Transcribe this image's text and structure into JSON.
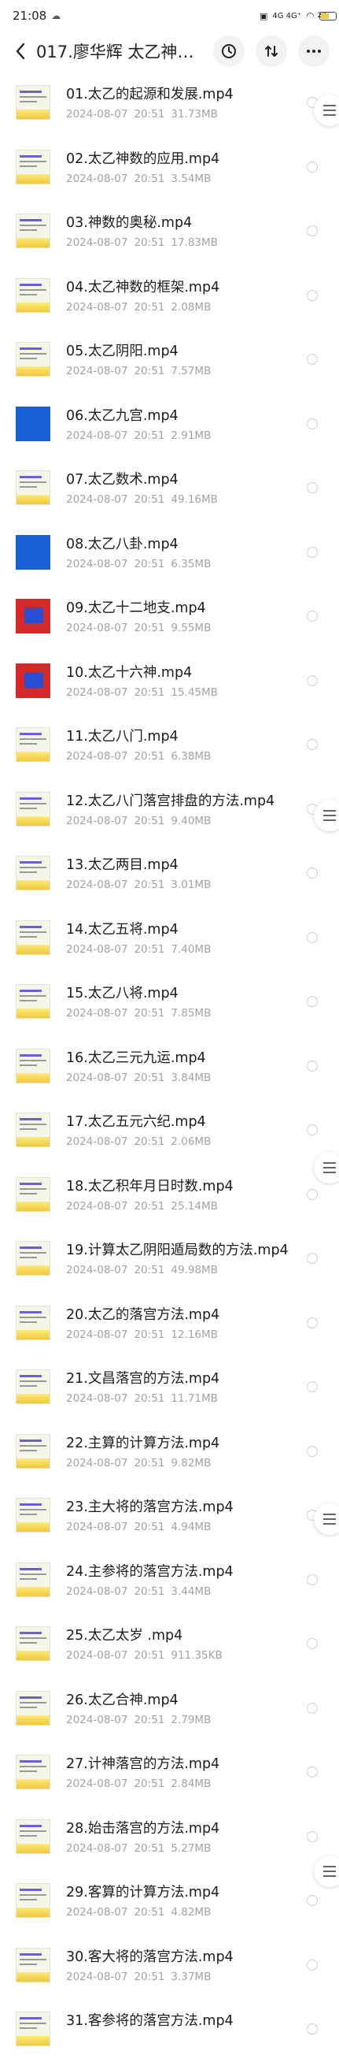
{
  "status": {
    "time": "21:08",
    "network": "4G 4G⁺",
    "battery": "27"
  },
  "header": {
    "title": "017.廖华辉 太乙神…"
  },
  "files": [
    {
      "name": "01.太乙的起源和发展.mp4",
      "date": "2024-08-07",
      "time": "20:51",
      "size": "31.73MB",
      "thumb": "text"
    },
    {
      "name": "02.太乙神数的应用.mp4",
      "date": "2024-08-07",
      "time": "20:51",
      "size": "3.54MB",
      "thumb": "text"
    },
    {
      "name": "03.神数的奥秘.mp4",
      "date": "2024-08-07",
      "time": "20:51",
      "size": "17.83MB",
      "thumb": "text"
    },
    {
      "name": "04.太乙神数的框架.mp4",
      "date": "2024-08-07",
      "time": "20:51",
      "size": "2.08MB",
      "thumb": "text"
    },
    {
      "name": "05.太乙阴阳.mp4",
      "date": "2024-08-07",
      "time": "20:51",
      "size": "7.57MB",
      "thumb": "text"
    },
    {
      "name": "06.太乙九宫.mp4",
      "date": "2024-08-07",
      "time": "20:51",
      "size": "2.91MB",
      "thumb": "blue"
    },
    {
      "name": "07.太乙数术.mp4",
      "date": "2024-08-07",
      "time": "20:51",
      "size": "49.16MB",
      "thumb": "text"
    },
    {
      "name": "08.太乙八卦.mp4",
      "date": "2024-08-07",
      "time": "20:51",
      "size": "6.35MB",
      "thumb": "blue"
    },
    {
      "name": "09.太乙十二地支.mp4",
      "date": "2024-08-07",
      "time": "20:51",
      "size": "9.55MB",
      "thumb": "red"
    },
    {
      "name": "10.太乙十六神.mp4",
      "date": "2024-08-07",
      "time": "20:51",
      "size": "15.45MB",
      "thumb": "red"
    },
    {
      "name": "11.太乙八门.mp4",
      "date": "2024-08-07",
      "time": "20:51",
      "size": "6.38MB",
      "thumb": "text"
    },
    {
      "name": "12.太乙八门落宫排盘的方法.mp4",
      "date": "2024-08-07",
      "time": "20:51",
      "size": "9.40MB",
      "thumb": "text"
    },
    {
      "name": "13.太乙两目.mp4",
      "date": "2024-08-07",
      "time": "20:51",
      "size": "3.01MB",
      "thumb": "text"
    },
    {
      "name": "14.太乙五将.mp4",
      "date": "2024-08-07",
      "time": "20:51",
      "size": "7.40MB",
      "thumb": "text"
    },
    {
      "name": "15.太乙八将.mp4",
      "date": "2024-08-07",
      "time": "20:51",
      "size": "7.85MB",
      "thumb": "text"
    },
    {
      "name": "16.太乙三元九运.mp4",
      "date": "2024-08-07",
      "time": "20:51",
      "size": "3.84MB",
      "thumb": "text"
    },
    {
      "name": "17.太乙五元六纪.mp4",
      "date": "2024-08-07",
      "time": "20:51",
      "size": "2.06MB",
      "thumb": "text"
    },
    {
      "name": "18.太乙积年月日时数.mp4",
      "date": "2024-08-07",
      "time": "20:51",
      "size": "25.14MB",
      "thumb": "text"
    },
    {
      "name": "19.计算太乙阴阳遁局数的方法.mp4",
      "date": "2024-08-07",
      "time": "20:51",
      "size": "49.98MB",
      "thumb": "text"
    },
    {
      "name": "20.太乙的落宫方法.mp4",
      "date": "2024-08-07",
      "time": "20:51",
      "size": "12.16MB",
      "thumb": "text"
    },
    {
      "name": "21.文昌落宫的方法.mp4",
      "date": "2024-08-07",
      "time": "20:51",
      "size": "11.71MB",
      "thumb": "text"
    },
    {
      "name": "22.主算的计算方法.mp4",
      "date": "2024-08-07",
      "time": "20:51",
      "size": "9.82MB",
      "thumb": "text"
    },
    {
      "name": "23.主大将的落宫方法.mp4",
      "date": "2024-08-07",
      "time": "20:51",
      "size": "4.94MB",
      "thumb": "text"
    },
    {
      "name": "24.主参将的落宫方法.mp4",
      "date": "2024-08-07",
      "time": "20:51",
      "size": "3.44MB",
      "thumb": "text"
    },
    {
      "name": "25.太乙太岁 .mp4",
      "date": "2024-08-07",
      "time": "20:51",
      "size": "911.35KB",
      "thumb": "text"
    },
    {
      "name": "26.太乙合神.mp4",
      "date": "2024-08-07",
      "time": "20:51",
      "size": "2.79MB",
      "thumb": "text"
    },
    {
      "name": "27.计神落宫的方法.mp4",
      "date": "2024-08-07",
      "time": "20:51",
      "size": "2.84MB",
      "thumb": "text"
    },
    {
      "name": "28.始击落宫的方法.mp4",
      "date": "2024-08-07",
      "time": "20:51",
      "size": "5.27MB",
      "thumb": "text"
    },
    {
      "name": "29.客算的计算方法.mp4",
      "date": "2024-08-07",
      "time": "20:51",
      "size": "4.82MB",
      "thumb": "text"
    },
    {
      "name": "30.客大将的落宫方法.mp4",
      "date": "2024-08-07",
      "time": "20:51",
      "size": "3.37MB",
      "thumb": "text"
    },
    {
      "name": "31.客参将的落宫方法.mp4",
      "date": "",
      "time": "",
      "size": "",
      "thumb": "text"
    }
  ],
  "icons": {
    "back": "back-arrow-icon",
    "history": "history-icon",
    "sort": "sort-icon",
    "more": "more-icon",
    "handle": "menu-handle-icon"
  }
}
